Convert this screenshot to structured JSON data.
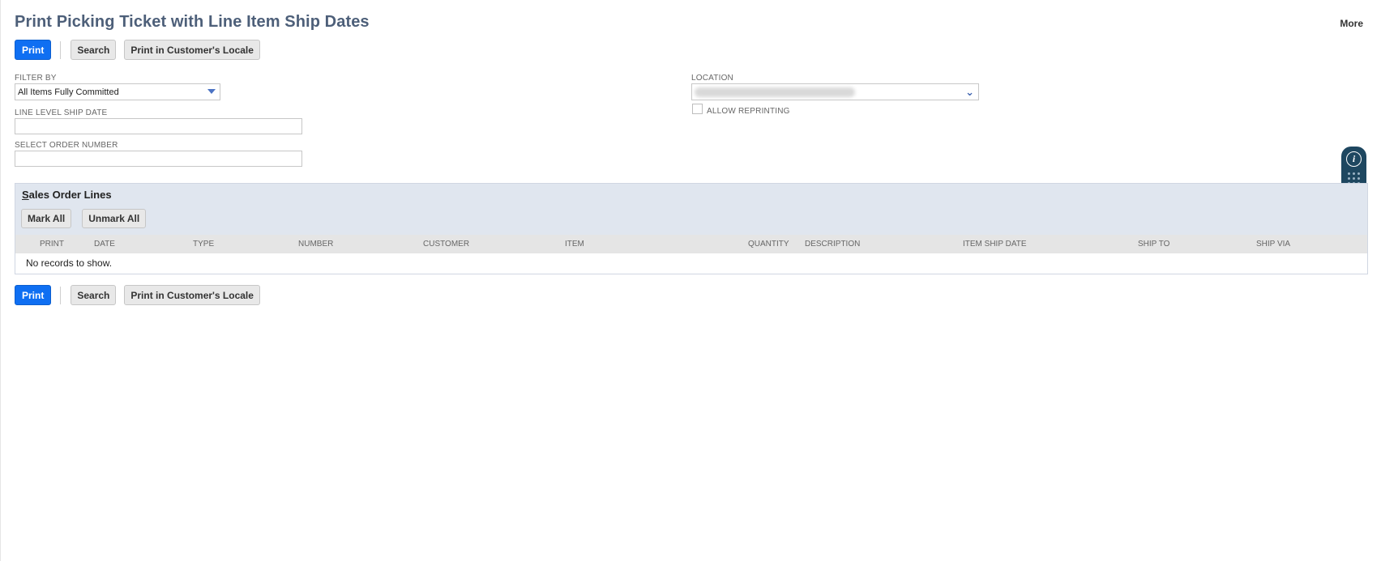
{
  "page": {
    "title": "Print Picking Ticket with Line Item Ship Dates",
    "more_label": "More"
  },
  "toolbar": {
    "print_label": "Print",
    "search_label": "Search",
    "print_locale_label": "Print in Customer's Locale"
  },
  "filters": {
    "filter_by_label": "FILTER BY",
    "filter_by_value": "All Items Fully Committed",
    "line_ship_date_label": "LINE LEVEL SHIP DATE",
    "line_ship_date_value": "",
    "order_number_label": "SELECT ORDER NUMBER",
    "order_number_value": "",
    "location_label": "LOCATION",
    "allow_reprinting_label": "ALLOW REPRINTING"
  },
  "sublist": {
    "title_first": "S",
    "title_rest": "ales Order Lines",
    "mark_all_label": "Mark All",
    "unmark_all_label": "Unmark All",
    "columns": [
      "PRINT",
      "DATE",
      "TYPE",
      "NUMBER",
      "CUSTOMER",
      "ITEM",
      "QUANTITY",
      "DESCRIPTION",
      "ITEM SHIP DATE",
      "SHIP TO",
      "SHIP VIA"
    ],
    "empty_message": "No records to show."
  },
  "icons": {
    "info": "info-icon",
    "grid": "grid-dots-icon",
    "dropdown": "chevron-down-icon",
    "double_chevron": "double-chevron-down-icon"
  },
  "colors": {
    "primary_button": "#0f6ff2",
    "title": "#4d5f79",
    "sublist_header": "#e0e6ef",
    "help_widget": "#1e4760"
  }
}
